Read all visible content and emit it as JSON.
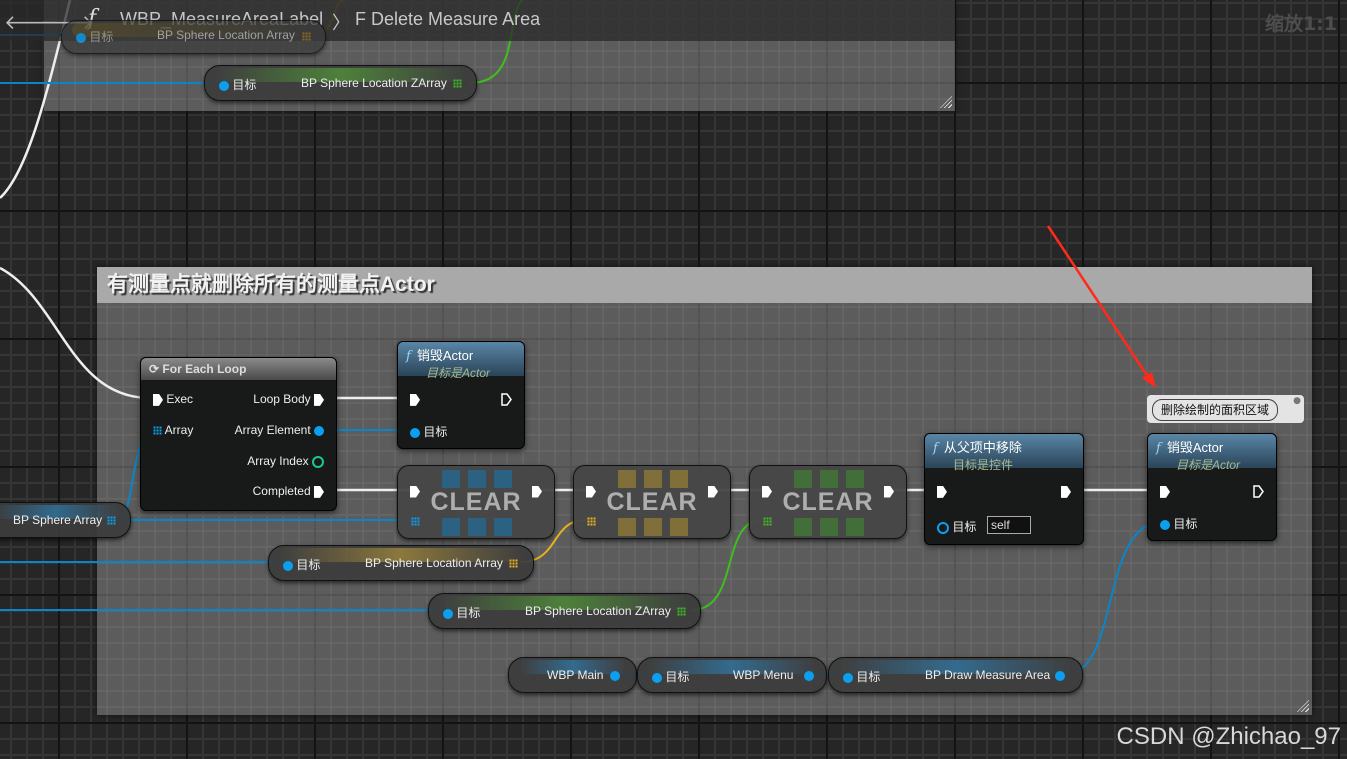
{
  "breadcrumb": {
    "graph": "WBP_MeasureAreaLabel",
    "separator": "〉",
    "function": "F Delete Measure Area",
    "back_icon": "arrow-left-icon",
    "forward_icon": "arrow-right-icon"
  },
  "zoom_label": "缩放1:1",
  "upper_area": {
    "var_top": {
      "target_label": "目标",
      "name": "BP Sphere Location Array"
    },
    "var_zarray": {
      "target_label": "目标",
      "name": "BP Sphere Location ZArray"
    }
  },
  "comment": {
    "title": "有测量点就删除所有的测量点Actor"
  },
  "for_each_loop": {
    "title": "For Each Loop",
    "pins_in": [
      "Exec",
      "Array"
    ],
    "pins_out": [
      "Loop Body",
      "Array Element",
      "Array Index",
      "Completed"
    ]
  },
  "destroy_actor_1": {
    "title": "销毁Actor",
    "subtitle": "目标是Actor",
    "target_label": "目标"
  },
  "destroy_actor_2": {
    "title": "销毁Actor",
    "subtitle": "目标是Actor",
    "target_label": "目标"
  },
  "remove_from_parent": {
    "title": "从父项中移除",
    "subtitle": "目标是控件",
    "target_label": "目标",
    "target_value": "self"
  },
  "clear_nodes": [
    {
      "label": "CLEAR",
      "color": "#0aa0ef"
    },
    {
      "label": "CLEAR",
      "color": "#e8b21c"
    },
    {
      "label": "CLEAR",
      "color": "#3dbf1e"
    }
  ],
  "variables": {
    "bp_sphere_array": "BP Sphere Array",
    "location_array": {
      "target_label": "目标",
      "name": "BP Sphere Location Array"
    },
    "location_zarray": {
      "target_label": "目标",
      "name": "BP Sphere Location ZArray"
    },
    "wbp_main": "WBP Main",
    "wbp_menu": {
      "target_label": "目标",
      "name": "WBP Menu"
    },
    "draw_measure_area": {
      "target_label": "目标",
      "name": "BP Draw Measure Area"
    }
  },
  "node_comment_bubble": "删除绘制的面积区域",
  "watermark": "CSDN @Zhichao_97",
  "colors": {
    "exec_wire": "#ffffff",
    "object_pin": "#0aa0ef",
    "location_array": "#e8b21c",
    "location_zarray": "#3dbf1e",
    "int_pin": "#17c98f",
    "annotation_arrow": "#ff2a1a"
  }
}
